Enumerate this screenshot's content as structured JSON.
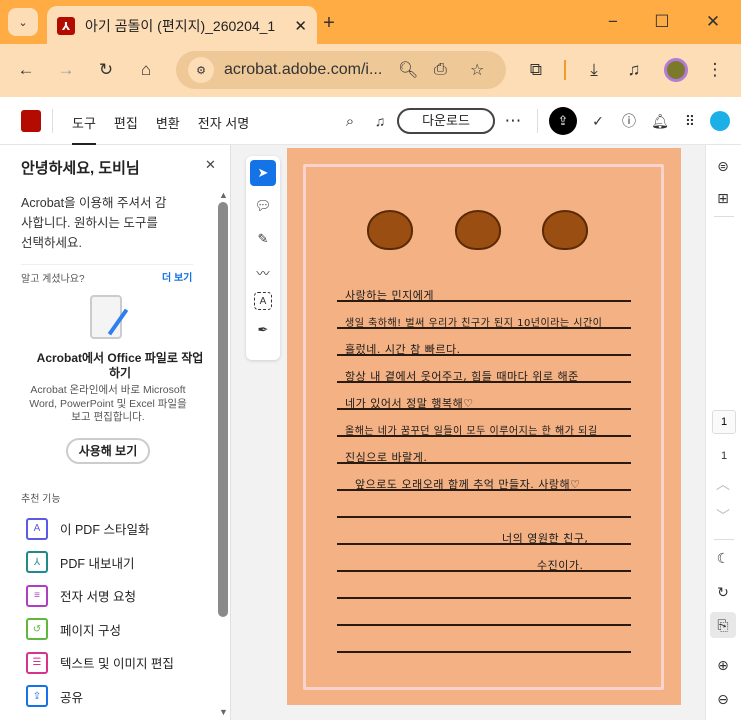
{
  "browser": {
    "tab_title": "아기 곰돌이 (편지지)_260204_1",
    "url": "acrobat.adobe.com/i..."
  },
  "app": {
    "nav": [
      "도구",
      "편집",
      "변환",
      "전자 서명"
    ],
    "download_label": "다운로드"
  },
  "sidebar": {
    "greeting": "안녕하세요, 도비님",
    "intro": "Acrobat을 이용해 주셔서 감사합니다. 원하시는 도구를 선택하세요.",
    "did_you_know": "알고 계셨나요?",
    "more_link": "더 보기",
    "promo_title": "Acrobat에서 Office 파일로 작업하기",
    "promo_body": "Acrobat 온라인에서 바로 Microsoft Word, PowerPoint 및 Excel 파일을 보고 편집합니다.",
    "try_button": "사용해 보기",
    "recommended": "추천 기능",
    "features": [
      {
        "label": "이 PDF 스타일화",
        "icon": "stylize-icon",
        "color": "#5A5AE6"
      },
      {
        "label": "PDF 내보내기",
        "icon": "export-pdf-icon",
        "color": "#1F8A8A"
      },
      {
        "label": "전자 서명 요청",
        "icon": "request-signature-icon",
        "color": "#B03DC4"
      },
      {
        "label": "페이지 구성",
        "icon": "organize-pages-icon",
        "color": "#5FB83A"
      },
      {
        "label": "텍스트 및 이미지 편집",
        "icon": "edit-text-image-icon",
        "color": "#D6338A"
      },
      {
        "label": "공유",
        "icon": "share-icon",
        "color": "#1473E6"
      }
    ]
  },
  "letter": {
    "lines": [
      "사랑하는 민지에게",
      "생일 축하해! 벌써 우리가 친구가 된지 10년이라는 시간이",
      "흘렀네. 시간 참 빠르다.",
      "항상 내 곁에서 웃어주고, 힘들 때마다 위로 해준",
      "네가 있어서 정말 행복해♡",
      "올해는 네가 꿈꾸던 일들이 모두 이루어지는 한 해가 되길",
      "진심으로 바랄게.",
      "앞으로도 오래오래 함께 추억 만들자. 사랑해♡"
    ],
    "sign1": "너의 영원한 친구,",
    "sign2": "수진이가."
  },
  "rail": {
    "page_input": "1",
    "page_total": "1"
  }
}
